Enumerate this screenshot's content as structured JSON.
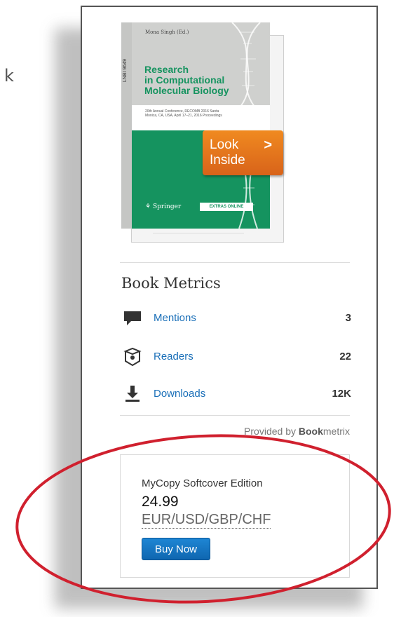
{
  "page": {
    "left_text": "k"
  },
  "book": {
    "editor": "Mona Singh (Ed.)",
    "spine_text": "LNBI 9649",
    "title_lines": [
      "Research",
      "in Computational",
      "Molecular Biology"
    ],
    "subtitle": "20th Annual Conference, RECOMB 2016 Santa Monica, CA, USA, April 17–21, 2016 Proceedings",
    "publisher": "Springer",
    "extras_label": "EXTRAS ONLINE",
    "look_inside_line1": "Look",
    "look_inside_line2": "Inside",
    "look_inside_icon": "chevron-right-icon",
    "colors": {
      "cover_green": "#15935f",
      "look_inside_orange": "#e8791d"
    }
  },
  "metrics": {
    "title": "Book Metrics",
    "rows": [
      {
        "icon": "speech-bubble-icon",
        "label": "Mentions",
        "value": "3"
      },
      {
        "icon": "readers-icon",
        "label": "Readers",
        "value": "22"
      },
      {
        "icon": "download-icon",
        "label": "Downloads",
        "value": "12K"
      }
    ],
    "provided_prefix": "Provided by ",
    "provided_brand": "Book",
    "provided_suffix": "metrix",
    "link_color": "#1a6fb8"
  },
  "purchase": {
    "edition": "MyCopy Softcover Edition",
    "price": "24.99",
    "currency": "EUR/USD/GBP/CHF",
    "button": "Buy Now",
    "button_color": "#1476c6",
    "highlight_color": "#d0202e"
  }
}
